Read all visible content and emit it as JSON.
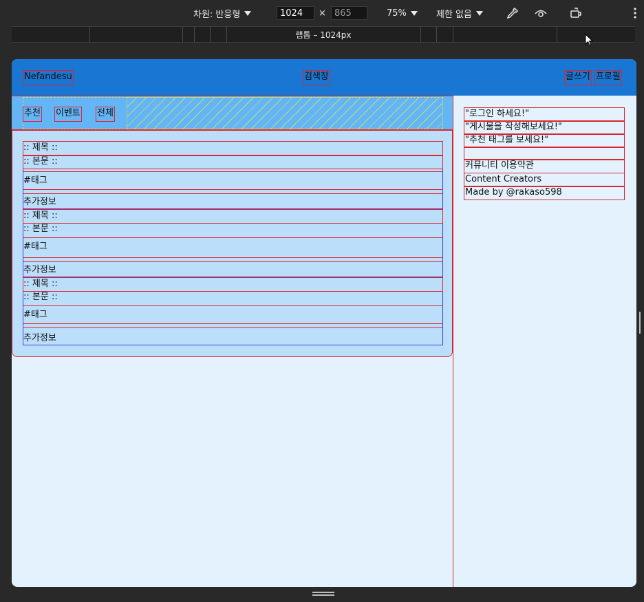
{
  "toolbar": {
    "dimension_label": "차원: 반응형",
    "width_value": "1024",
    "height_value": "865",
    "times": "×",
    "zoom": "75%",
    "throttle": "제한 없음"
  },
  "ruler": {
    "label": "랩톱 – 1024px"
  },
  "header": {
    "brand": "Nefandesu",
    "search": "검색창",
    "write": "글쓰기",
    "profile": "프로필"
  },
  "tabs": [
    "추천",
    "이벤트",
    "전체"
  ],
  "posts": [
    {
      "title": ":: 제목 ::",
      "body": ":: 본문 ::",
      "tag": "#태그",
      "extra": "추가정보"
    },
    {
      "title": ":: 제목 ::",
      "body": ":: 본문 ::",
      "tag": "#태그",
      "extra": "추가정보"
    },
    {
      "title": ":: 제목 ::",
      "body": ":: 본문 ::",
      "tag": "#태그",
      "extra": "추가정보"
    }
  ],
  "sidebar": {
    "messages": [
      "\"로그인 하세요!\"",
      "\"게시물을 작성해보세요!\"",
      "\"추천 태그를 보세요!\""
    ],
    "links": [
      "커뮤니티 이용약관",
      "Content Creators",
      "Made by @rakaso598"
    ]
  },
  "colors": {
    "header": "#1976d2",
    "tabbar": "#64b5f6",
    "feed": "#bbdefb",
    "page": "#e3f2fd",
    "outline_red": "#e0242e",
    "outline_blue": "#3b3bd6"
  }
}
